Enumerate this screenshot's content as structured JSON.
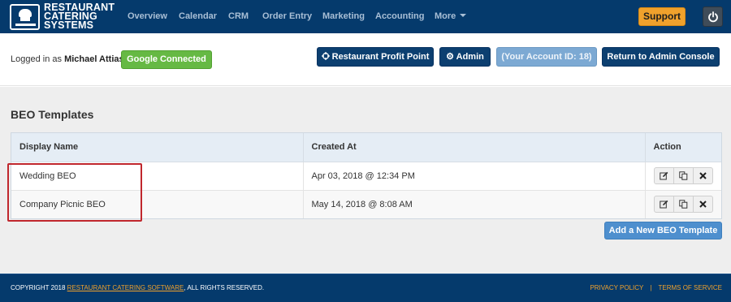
{
  "brand": {
    "logo_lines": [
      "RESTAURANT",
      "CATERING",
      "SYSTEMS"
    ],
    "logo_icon": "chef-hat-icon"
  },
  "nav": {
    "items": [
      "Overview",
      "Calendar",
      "CRM",
      "Order Entry",
      "Marketing",
      "Accounting",
      "More"
    ],
    "support_label": "Support",
    "power_icon": "power-icon"
  },
  "account": {
    "logged_in_prefix": "Logged in as",
    "user_name": "Michael Attias",
    "google_status": "Google Connected",
    "profit_point_label": "Restaurant Profit Point",
    "admin_label": "Admin",
    "account_id_label": "(Your Account ID: 18)",
    "return_label": "Return to Admin Console"
  },
  "page": {
    "title": "BEO Templates"
  },
  "table": {
    "headers": [
      "Display Name",
      "Created At",
      "Action"
    ],
    "rows": [
      {
        "name": "Wedding BEO",
        "created": "Apr 03, 2018 @ 12:34 PM"
      },
      {
        "name": "Company Picnic BEO",
        "created": "May 14, 2018 @ 8:08 AM"
      }
    ],
    "action_icons": [
      "edit-icon",
      "copy-icon",
      "delete-icon"
    ]
  },
  "add_button_label": "Add a New BEO Template",
  "footer": {
    "copyright_prefix": "COPYRIGHT 2018",
    "brand_link": "RESTAURANT CATERING SOFTWARE",
    "copyright_suffix": ", ALL RIGHTS RESERVED.",
    "privacy": "PRIVACY POLICY",
    "separator": "|",
    "terms": "TERMS OF SERVICE"
  },
  "colors": {
    "navbar": "#053a6c",
    "accent_orange": "#f0a12c",
    "google_green": "#66b944",
    "primary_button": "#4e8fce",
    "highlight_red": "#c0272d"
  }
}
